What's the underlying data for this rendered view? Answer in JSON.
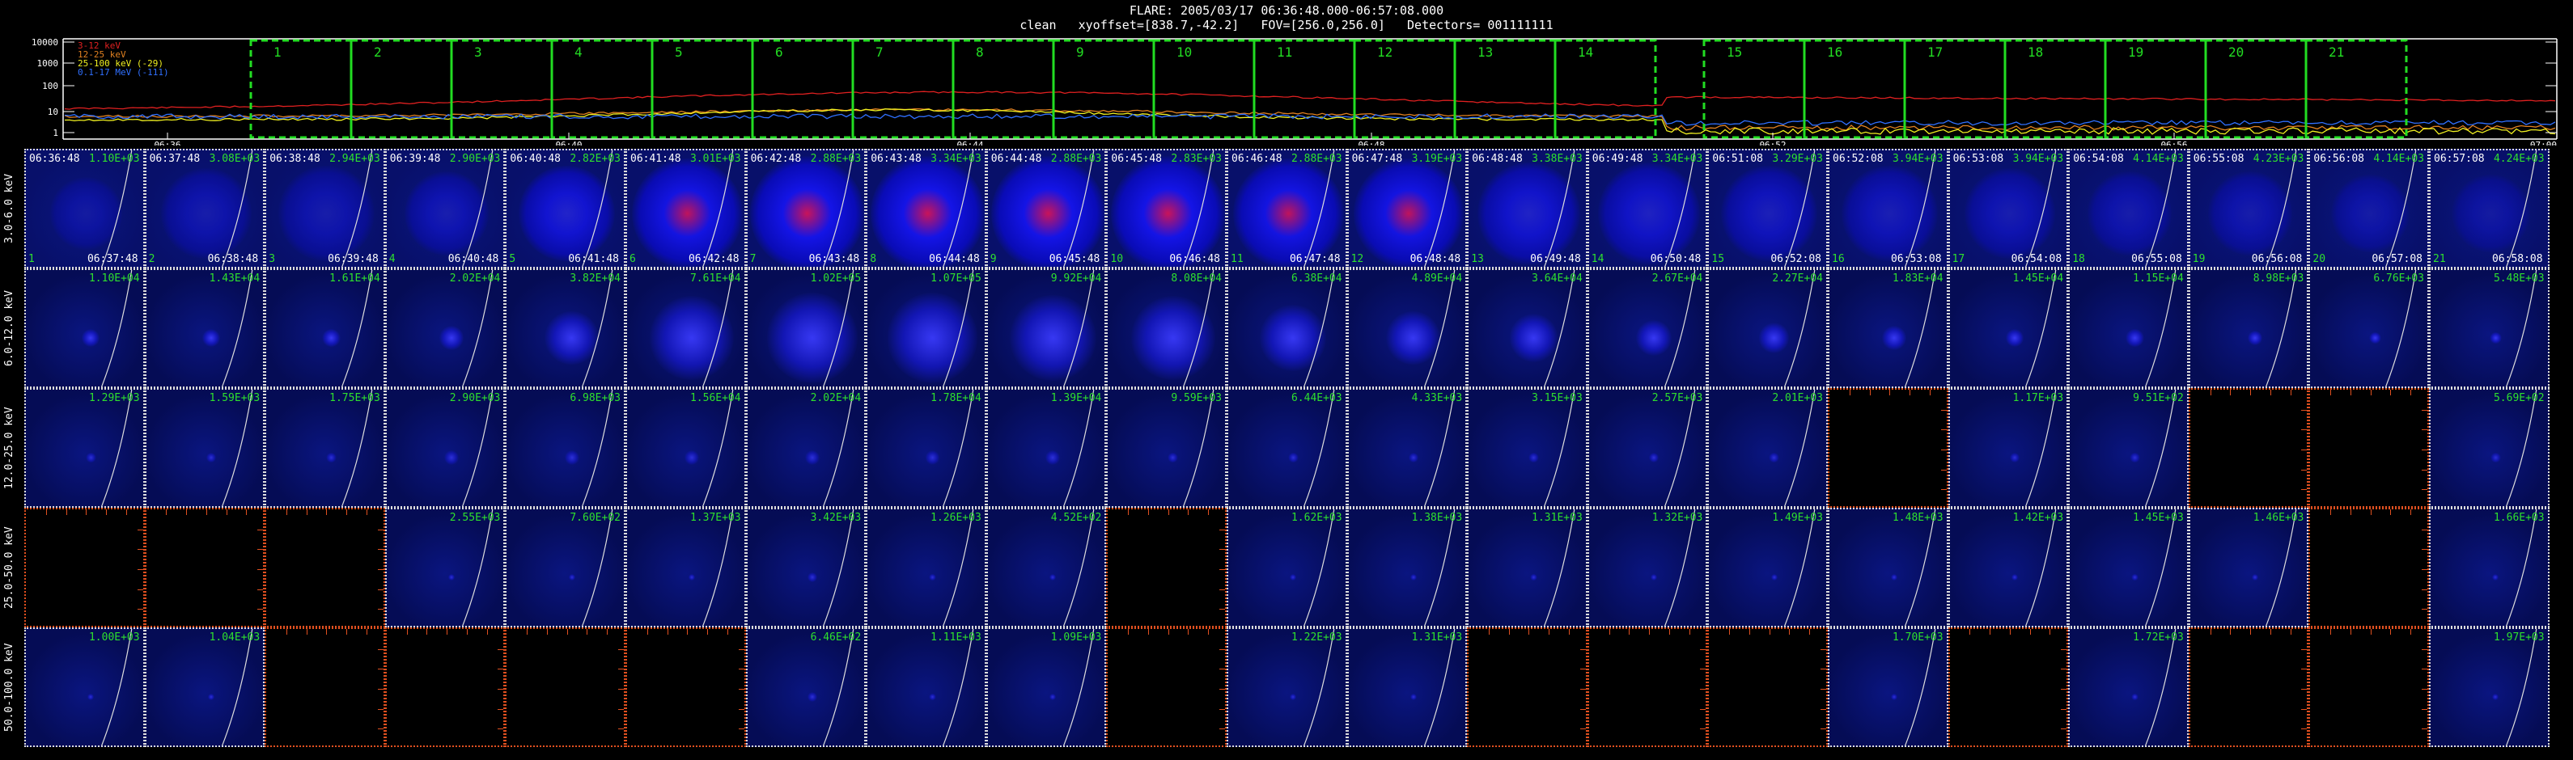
{
  "header": {
    "line1": "FLARE: 2005/03/17 06:36:48.000-06:57:08.000",
    "line2": "clean   xyoffset=[838.7,-42.2]   FOV=[256.0,256.0]   Detectors= 001111111"
  },
  "lightcurve": {
    "y_ticks": [
      "10000",
      "1000",
      "100",
      "10",
      "1"
    ],
    "x_ticks": [
      "06:36",
      "06:40",
      "06:44",
      "06:48",
      "06:52",
      "06:56",
      "07:00"
    ],
    "legend": [
      {
        "label": "3-12 keV",
        "color": "#e02020"
      },
      {
        "label": "12-25 keV",
        "color": "#e08020"
      },
      {
        "label": "25-100 keV (-29)",
        "color": "#f0f020"
      },
      {
        "label": "0.1-17 MeV (-111)",
        "color": "#3070ff"
      }
    ],
    "interval_numbers": [
      "1",
      "2",
      "3",
      "4",
      "5",
      "6",
      "7",
      "8",
      "9",
      "10",
      "11",
      "12",
      "13",
      "14",
      "15",
      "16",
      "17",
      "18",
      "19",
      "20",
      "21"
    ],
    "box_color": "#22dd22"
  },
  "energy_bands": [
    "3.0-6.0 keV",
    "6.0-12.0 keV",
    "12.0-25.0 keV",
    "25.0-50.0 keV",
    "50.0-100.0 keV"
  ],
  "start_times": [
    "06:36:48",
    "06:37:48",
    "06:38:48",
    "06:39:48",
    "06:40:48",
    "06:41:48",
    "06:42:48",
    "06:43:48",
    "06:44:48",
    "06:45:48",
    "06:46:48",
    "06:47:48",
    "06:48:48",
    "06:49:48",
    "06:51:08",
    "06:52:08",
    "06:53:08",
    "06:54:08",
    "06:55:08",
    "06:56:08",
    "06:57:08"
  ],
  "end_times": [
    "06:37:48",
    "06:38:48",
    "06:39:48",
    "06:40:48",
    "06:41:48",
    "06:42:48",
    "06:43:48",
    "06:44:48",
    "06:45:48",
    "06:46:48",
    "06:47:48",
    "06:48:48",
    "06:49:48",
    "06:50:48",
    "06:52:08",
    "06:53:08",
    "06:54:08",
    "06:55:08",
    "06:56:08",
    "06:57:08",
    "06:58:08"
  ],
  "panel_numbers": [
    "1",
    "2",
    "3",
    "4",
    "5",
    "6",
    "7",
    "8",
    "9",
    "10",
    "11",
    "12",
    "13",
    "14",
    "15",
    "16",
    "17",
    "18",
    "19",
    "20",
    "21"
  ],
  "flux_rows": [
    [
      "1.10E+03",
      "3.08E+03",
      "2.94E+03",
      "2.90E+03",
      "2.82E+03",
      "3.01E+03",
      "2.88E+03",
      "3.34E+03",
      "2.88E+03",
      "2.83E+03",
      "2.88E+03",
      "3.19E+03",
      "3.38E+03",
      "3.34E+03",
      "3.29E+03",
      "3.94E+03",
      "3.94E+03",
      "4.14E+03",
      "4.23E+03",
      "4.14E+03",
      "4.24E+03"
    ],
    [
      "1.10E+04",
      "1.43E+04",
      "1.61E+04",
      "2.02E+04",
      "3.82E+04",
      "7.61E+04",
      "1.02E+05",
      "1.07E+05",
      "9.92E+04",
      "8.08E+04",
      "6.38E+04",
      "4.89E+04",
      "3.64E+04",
      "2.67E+04",
      "2.27E+04",
      "1.83E+04",
      "1.45E+04",
      "1.15E+04",
      "8.98E+03",
      "6.76E+03",
      "5.48E+03"
    ],
    [
      "1.29E+03",
      "1.59E+03",
      "1.75E+03",
      "2.90E+03",
      "6.98E+03",
      "1.56E+04",
      "2.02E+04",
      "1.78E+04",
      "1.39E+04",
      "9.59E+03",
      "6.44E+03",
      "4.33E+03",
      "3.15E+03",
      "2.57E+03",
      "2.01E+03",
      "",
      "1.17E+03",
      "9.51E+02",
      "",
      "",
      "5.69E+02"
    ],
    [
      "",
      "",
      "",
      "2.55E+03",
      "7.60E+02",
      "1.37E+03",
      "3.42E+03",
      "1.26E+03",
      "4.52E+02",
      "",
      "1.62E+03",
      "1.38E+03",
      "1.31E+03",
      "1.32E+03",
      "1.49E+03",
      "1.48E+03",
      "1.42E+03",
      "1.45E+03",
      "1.46E+03",
      "",
      "1.66E+03"
    ],
    [
      "1.00E+03",
      "1.04E+03",
      "",
      "",
      "",
      "",
      "6.46E+02",
      "1.11E+03",
      "1.09E+03",
      "",
      "1.22E+03",
      "1.31E+03",
      "",
      "",
      "",
      "1.70E+03",
      "",
      "1.72E+03",
      "",
      "",
      "1.97E+03"
    ]
  ]
}
